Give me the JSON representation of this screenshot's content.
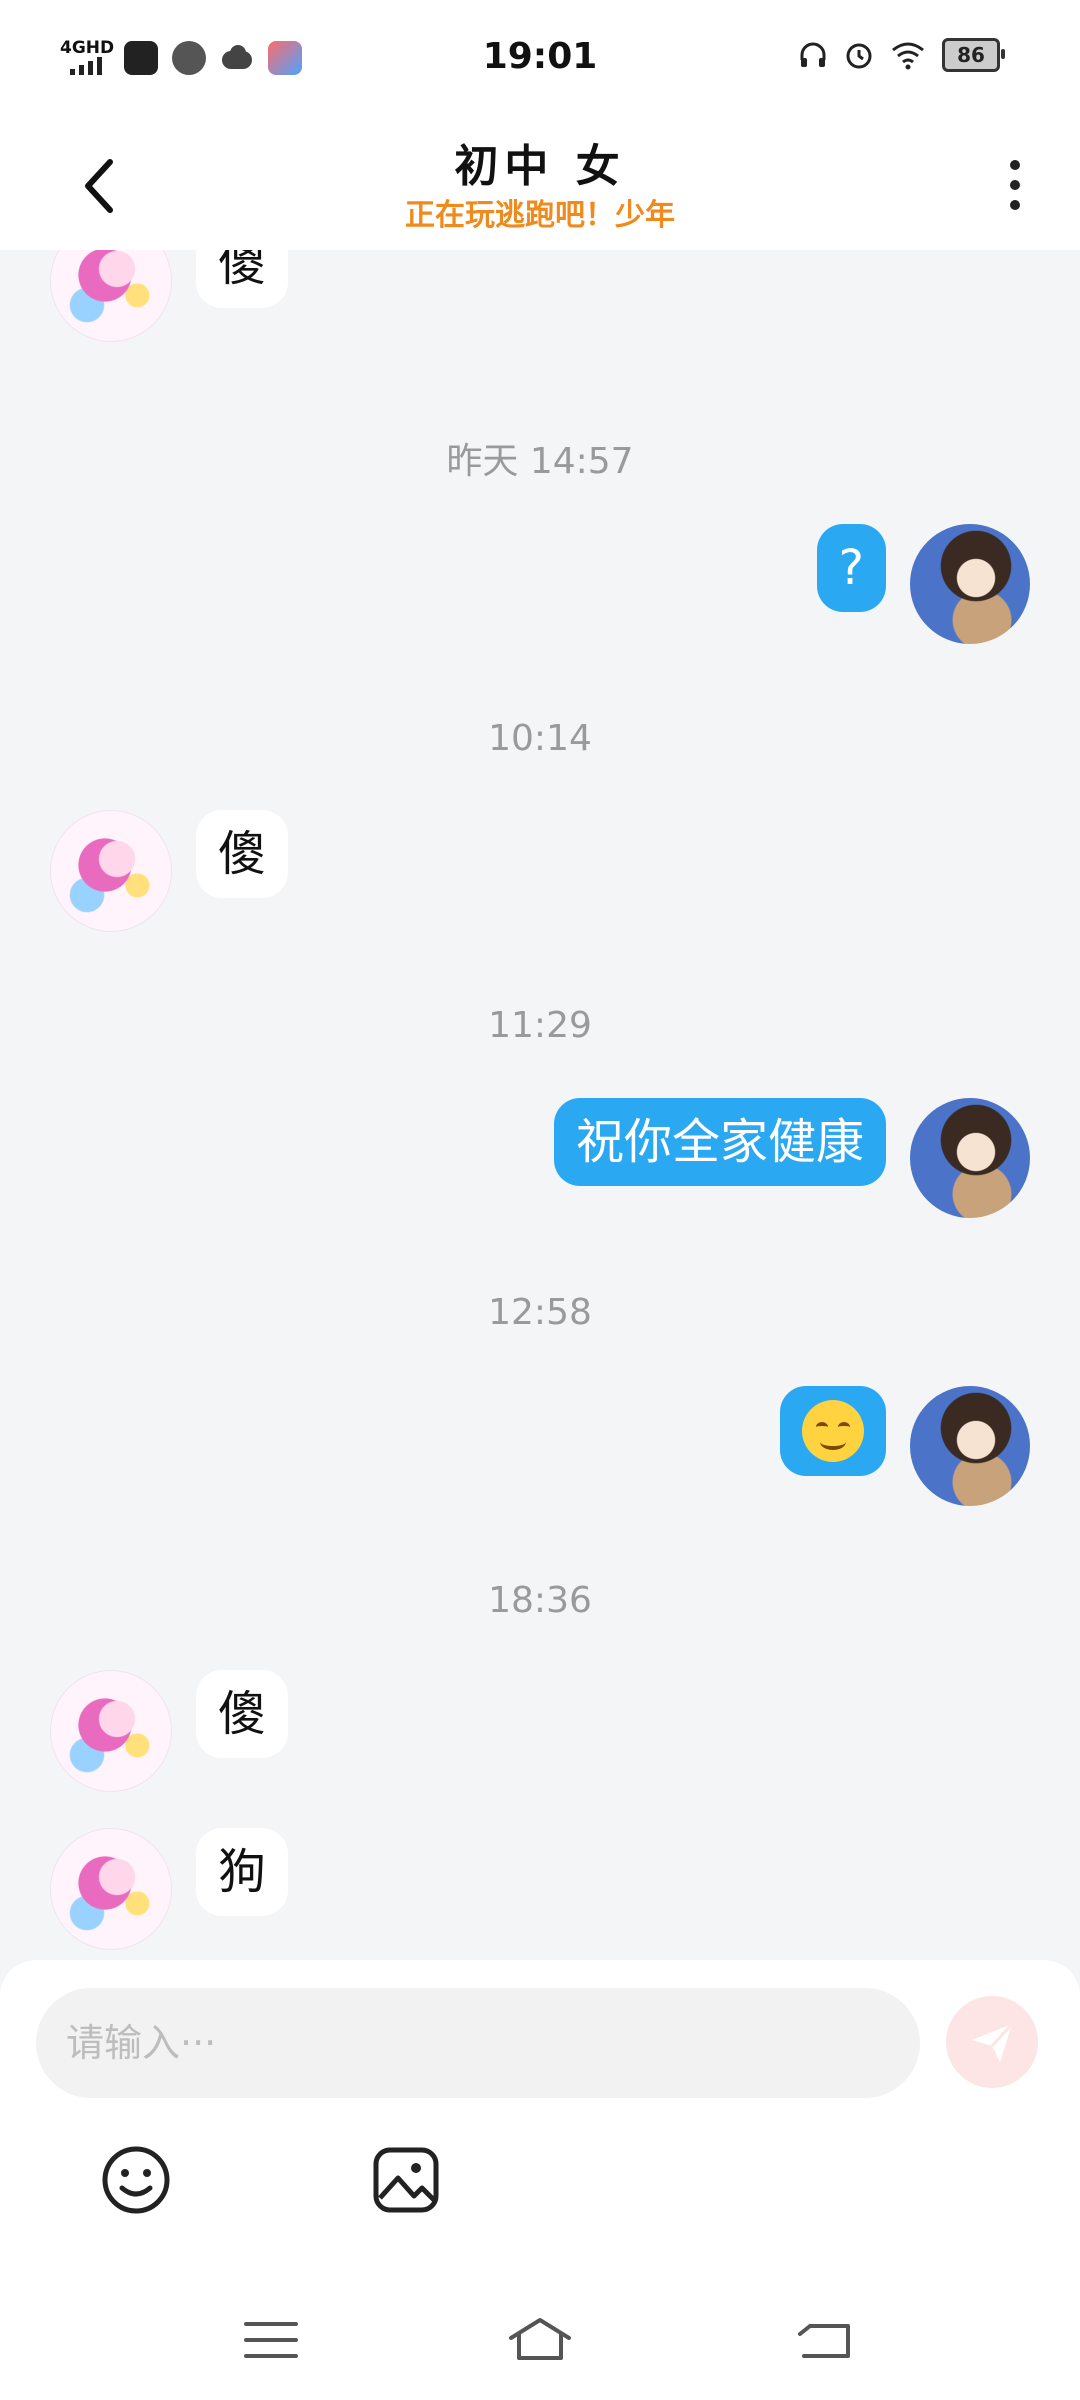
{
  "status_bar": {
    "network": "4GHD",
    "time": "19:01",
    "battery": "86",
    "icons": [
      "signal-icon",
      "app-icon",
      "voice-icon",
      "cloud-icon",
      "browser-icon",
      "headphones-icon",
      "alarm-icon",
      "wifi-icon",
      "battery-icon"
    ]
  },
  "header": {
    "title": "初中 女",
    "subtitle": "正在玩逃跑吧！少年",
    "icons": [
      "back-arrow-icon",
      "more-vertical-icon"
    ]
  },
  "chat": {
    "messages": [
      {
        "side": "left",
        "text": "傻"
      },
      {
        "timestamp": "昨天 14:57"
      },
      {
        "side": "right",
        "text": "?"
      },
      {
        "timestamp": "10:14"
      },
      {
        "side": "left",
        "text": "傻"
      },
      {
        "timestamp": "11:29"
      },
      {
        "side": "right",
        "text": "祝你全家健康"
      },
      {
        "timestamp": "12:58"
      },
      {
        "side": "right",
        "emoji": "smiling-face-emoji"
      },
      {
        "timestamp": "18:36"
      },
      {
        "side": "left",
        "text": "傻"
      },
      {
        "side": "left",
        "text": "狗"
      }
    ]
  },
  "input": {
    "placeholder": "请输入···"
  },
  "toolbar": {
    "icons": [
      "emoji-icon",
      "image-icon",
      "send-icon"
    ]
  },
  "navbar": {
    "icons": [
      "menu-icon",
      "home-icon",
      "back-icon"
    ]
  },
  "colors": {
    "accent_blue": "#2aa8f2",
    "subtitle_orange": "#f08a1c",
    "send_disabled": "#fde5e6",
    "background": "#f4f5f7"
  }
}
